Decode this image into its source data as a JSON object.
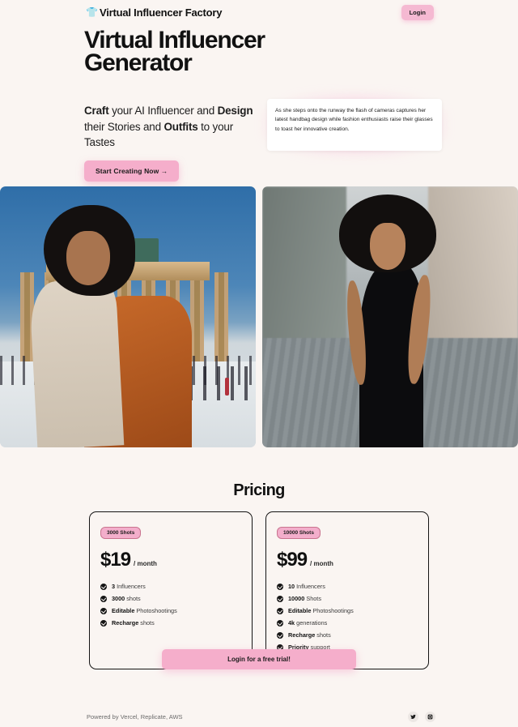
{
  "brand": {
    "icon": "👕",
    "name": "Virtual Influencer Factory"
  },
  "header": {
    "login_label": "Login"
  },
  "hero": {
    "title": "Virtual Influencer Generator",
    "subtitle_parts": {
      "b1": "Craft",
      "t1": " your AI Influencer and ",
      "b2": "Design",
      "t2": " their Stories and ",
      "b3": "Outfits",
      "t3": " to your Tastes"
    },
    "cta_label": "Start Creating Now  →",
    "quote": "As she steps onto the runway the flash of cameras captures her latest handbag design while fashion enthusiasts raise their glasses to toast her innovative creation."
  },
  "gallery": {
    "left_alt": "Woman with afro in orange coat and cream scarf at Brandenburg Gate in snow",
    "right_alt": "Woman with afro in black cut-out dress on a cobblestone street"
  },
  "pricing": {
    "title": "Pricing",
    "plans": [
      {
        "badge": "3000 Shots",
        "amount": "$19",
        "period": "/ month",
        "features": [
          {
            "strong": "3",
            "rest": " Influencers"
          },
          {
            "strong": "3000",
            "rest": " shots"
          },
          {
            "strong": "Editable",
            "rest": " Photoshootings"
          },
          {
            "strong": "Recharge",
            "rest": " shots"
          }
        ]
      },
      {
        "badge": "10000 Shots",
        "amount": "$99",
        "period": "/ month",
        "features": [
          {
            "strong": "10",
            "rest": " Influencers"
          },
          {
            "strong": "10000",
            "rest": " Shots"
          },
          {
            "strong": "Editable",
            "rest": " Photoshootings"
          },
          {
            "strong": "4k",
            "rest": " generations"
          },
          {
            "strong": "Recharge",
            "rest": " shots"
          },
          {
            "strong": "Priority",
            "rest": " support"
          }
        ]
      }
    ],
    "trial_label": "Login for a free trial!"
  },
  "footer": {
    "text": "Powered by Vercel, Replicate, AWS",
    "socials": [
      {
        "name": "twitter"
      },
      {
        "name": "instagram"
      }
    ]
  },
  "colors": {
    "background": "#faf5f2",
    "accent_pink": "#f5aecb",
    "text_dark": "#111111"
  }
}
